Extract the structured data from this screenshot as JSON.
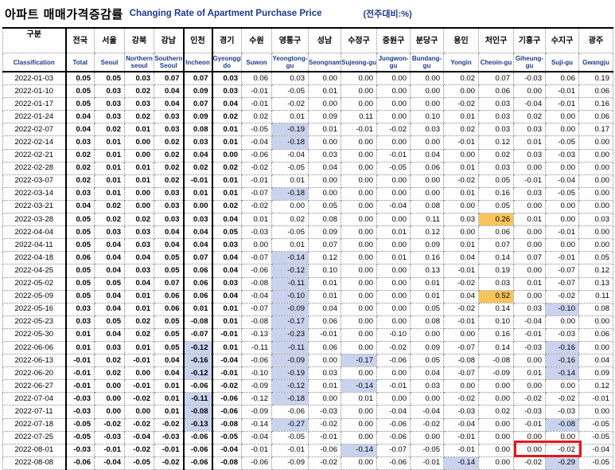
{
  "title": {
    "ko": "아파트 매매가격증감률",
    "en": "Changing Rate of Apartment Purchase Price",
    "unit": "(전주대비:%)"
  },
  "columns": [
    {
      "ko": "구분",
      "en": "Classification"
    },
    {
      "ko": "전국",
      "en": "Total"
    },
    {
      "ko": "서울",
      "en": "Seoul"
    },
    {
      "ko": "강북",
      "en": "Northern seoul"
    },
    {
      "ko": "강남",
      "en": "Southern Seoul"
    },
    {
      "ko": "인천",
      "en": "Incheon"
    },
    {
      "ko": "경기",
      "en": "Gyeonggi-do"
    },
    {
      "ko": "수원",
      "en": "Suwon"
    },
    {
      "ko": "영통구",
      "en": "Yeongtong-gu"
    },
    {
      "ko": "성남",
      "en": "Seongnam"
    },
    {
      "ko": "수정구",
      "en": "Sujeong-gu"
    },
    {
      "ko": "중원구",
      "en": "Jungwon-gu"
    },
    {
      "ko": "분당구",
      "en": "Bundang-gu"
    },
    {
      "ko": "용인",
      "en": "Yongin"
    },
    {
      "ko": "처인구",
      "en": "Cheoin-gu"
    },
    {
      "ko": "기흥구",
      "en": "Giheung-gu"
    },
    {
      "ko": "수지구",
      "en": "Suji-gu"
    },
    {
      "ko": "광주",
      "en": "Gwangju"
    }
  ],
  "rows": [
    [
      "2022-01-03",
      "0.05",
      "0.05",
      "0.03",
      "0.07",
      "0.07",
      "0.03",
      "0.06",
      "0.03",
      "0.00",
      "0.00",
      "0.00",
      "0.00",
      "0.02",
      "0.07",
      "-0.03",
      "0.06",
      "0.19"
    ],
    [
      "2022-01-10",
      "0.05",
      "0.03",
      "0.02",
      "0.04",
      "0.09",
      "0.03",
      "-0.01",
      "-0.05",
      "0.01",
      "0.00",
      "0.00",
      "0.00",
      "0.00",
      "0.06",
      "0.00",
      "-0.01",
      "0.06"
    ],
    [
      "2022-01-17",
      "0.05",
      "0.03",
      "0.03",
      "0.04",
      "0.07",
      "0.04",
      "-0.01",
      "-0.02",
      "0.00",
      "0.00",
      "0.00",
      "0.00",
      "-0.02",
      "0.03",
      "-0.04",
      "-0.01",
      "0.16"
    ],
    [
      "2022-01-24",
      "0.04",
      "0.03",
      "0.02",
      "0.03",
      "0.09",
      "0.02",
      "0.02",
      "0.01",
      "0.09",
      "0.11",
      "0.00",
      "0.10",
      "0.01",
      "0.03",
      "0.02",
      "0.00",
      "0.06"
    ],
    [
      "2022-02-07",
      "0.04",
      "0.02",
      "0.01",
      "0.03",
      "0.08",
      "0.01",
      "-0.05",
      "-0.19",
      "0.01",
      "-0.01",
      "-0.02",
      "0.03",
      "0.02",
      "0.03",
      "0.03",
      "0.00",
      "0.17"
    ],
    [
      "2022-02-14",
      "0.03",
      "0.01",
      "0.00",
      "0.02",
      "0.03",
      "0.01",
      "-0.04",
      "-0.18",
      "0.00",
      "0.00",
      "0.00",
      "0.00",
      "-0.01",
      "0.12",
      "0.01",
      "-0.05",
      "0.00"
    ],
    [
      "2022-02-21",
      "0.02",
      "0.01",
      "0.00",
      "0.02",
      "0.04",
      "0.00",
      "-0.06",
      "-0.04",
      "0.03",
      "0.00",
      "-0.01",
      "0.04",
      "0.00",
      "0.02",
      "0.03",
      "-0.03",
      "0.00"
    ],
    [
      "2022-02-28",
      "0.02",
      "0.01",
      "0.01",
      "0.02",
      "0.02",
      "0.02",
      "-0.02",
      "-0.05",
      "0.04",
      "0.00",
      "-0.05",
      "0.06",
      "0.01",
      "0.03",
      "0.00",
      "0.00",
      "0.00"
    ],
    [
      "2022-03-07",
      "0.02",
      "0.01",
      "0.01",
      "0.02",
      "-0.01",
      "0.01",
      "-0.01",
      "0.01",
      "0.00",
      "0.00",
      "0.00",
      "0.00",
      "-0.02",
      "0.05",
      "-0.01",
      "-0.04",
      "0.00"
    ],
    [
      "2022-03-14",
      "0.03",
      "0.01",
      "0.00",
      "0.03",
      "0.01",
      "0.01",
      "-0.07",
      "-0.18",
      "0.00",
      "0.00",
      "0.00",
      "0.00",
      "0.01",
      "0.16",
      "0.03",
      "-0.05",
      "0.00"
    ],
    [
      "2022-03-21",
      "0.04",
      "0.02",
      "0.00",
      "0.03",
      "0.00",
      "0.02",
      "-0.02",
      "0.00",
      "0.05",
      "0.00",
      "-0.04",
      "0.08",
      "0.00",
      "0.05",
      "0.00",
      "0.00",
      "0.00"
    ],
    [
      "2022-03-28",
      "0.05",
      "0.02",
      "0.02",
      "0.03",
      "0.03",
      "0.04",
      "0.01",
      "0.02",
      "0.08",
      "0.00",
      "0.00",
      "0.11",
      "0.03",
      "0.26",
      "0.01",
      "0.00",
      "0.03"
    ],
    [
      "2022-04-04",
      "0.05",
      "0.03",
      "0.03",
      "0.04",
      "0.04",
      "0.05",
      "-0.03",
      "-0.05",
      "0.09",
      "0.00",
      "0.01",
      "0.12",
      "0.00",
      "0.06",
      "0.00",
      "-0.01",
      "0.00"
    ],
    [
      "2022-04-11",
      "0.05",
      "0.04",
      "0.03",
      "0.04",
      "0.04",
      "0.03",
      "0.00",
      "0.01",
      "0.07",
      "0.00",
      "0.00",
      "0.09",
      "0.01",
      "0.07",
      "0.00",
      "0.00",
      "0.00"
    ],
    [
      "2022-04-18",
      "0.06",
      "0.04",
      "0.04",
      "0.05",
      "0.07",
      "0.04",
      "-0.07",
      "-0.14",
      "0.12",
      "0.00",
      "0.01",
      "0.16",
      "0.04",
      "0.14",
      "0.07",
      "-0.01",
      "0.05"
    ],
    [
      "2022-04-25",
      "0.05",
      "0.04",
      "0.03",
      "0.05",
      "0.06",
      "0.04",
      "-0.06",
      "-0.12",
      "0.10",
      "0.00",
      "0.00",
      "0.13",
      "-0.01",
      "0.19",
      "0.00",
      "-0.07",
      "0.12"
    ],
    [
      "2022-05-02",
      "0.05",
      "0.05",
      "0.04",
      "0.07",
      "0.06",
      "0.03",
      "-0.08",
      "-0.11",
      "0.01",
      "0.00",
      "0.00",
      "0.01",
      "-0.02",
      "0.03",
      "0.01",
      "-0.07",
      "0.13"
    ],
    [
      "2022-05-09",
      "0.05",
      "0.04",
      "0.01",
      "0.06",
      "0.06",
      "0.04",
      "-0.04",
      "-0.10",
      "0.01",
      "0.00",
      "0.00",
      "0.01",
      "0.04",
      "0.52",
      "0.00",
      "-0.02",
      "0.11"
    ],
    [
      "2022-05-16",
      "0.03",
      "0.04",
      "0.01",
      "0.06",
      "0.01",
      "0.01",
      "-0.07",
      "-0.09",
      "0.04",
      "0.00",
      "0.00",
      "0.05",
      "-0.02",
      "0.14",
      "0.03",
      "-0.10",
      "0.08"
    ],
    [
      "2022-05-23",
      "0.03",
      "0.05",
      "0.02",
      "0.05",
      "-0.08",
      "0.01",
      "-0.08",
      "-0.17",
      "0.06",
      "0.00",
      "0.00",
      "0.08",
      "-0.01",
      "0.10",
      "-0.04",
      "0.00",
      "0.00"
    ],
    [
      "2022-05-30",
      "0.01",
      "0.04",
      "0.02",
      "0.05",
      "-0.07",
      "-0.01",
      "-0.13",
      "-0.23",
      "-0.01",
      "0.00",
      "-0.10",
      "0.00",
      "0.00",
      "0.16",
      "-0.01",
      "-0.03",
      "0.06"
    ],
    [
      "2022-06-06",
      "0.01",
      "0.03",
      "0.01",
      "0.05",
      "-0.12",
      "0.01",
      "-0.11",
      "-0.11",
      "0.06",
      "0.00",
      "-0.02",
      "0.09",
      "-0.07",
      "0.14",
      "-0.03",
      "-0.16",
      "0.00"
    ],
    [
      "2022-06-13",
      "-0.01",
      "0.02",
      "-0.01",
      "0.04",
      "-0.16",
      "-0.04",
      "-0.06",
      "-0.09",
      "0.00",
      "-0.17",
      "-0.06",
      "0.05",
      "-0.08",
      "-0.08",
      "0.00",
      "-0.16",
      "0.04"
    ],
    [
      "2022-06-20",
      "-0.01",
      "0.02",
      "0.00",
      "0.04",
      "-0.12",
      "-0.01",
      "-0.10",
      "-0.19",
      "0.03",
      "0.00",
      "0.00",
      "0.04",
      "-0.07",
      "-0.09",
      "0.01",
      "-0.14",
      "0.09"
    ],
    [
      "2022-06-27",
      "-0.01",
      "0.00",
      "-0.01",
      "0.01",
      "-0.06",
      "-0.02",
      "-0.09",
      "-0.12",
      "0.01",
      "-0.14",
      "-0.01",
      "0.03",
      "0.00",
      "0.00",
      "0.00",
      "0.00",
      "0.12"
    ],
    [
      "2022-07-04",
      "-0.03",
      "0.00",
      "-0.02",
      "0.01",
      "-0.11",
      "-0.06",
      "-0.12",
      "-0.18",
      "0.00",
      "0.01",
      "0.00",
      "0.00",
      "-0.02",
      "0.00",
      "-0.02",
      "-0.02",
      "-0.01"
    ],
    [
      "2022-07-11",
      "-0.03",
      "0.00",
      "0.00",
      "0.01",
      "-0.08",
      "-0.06",
      "-0.09",
      "-0.06",
      "-0.03",
      "0.00",
      "-0.04",
      "-0.04",
      "-0.03",
      "0.02",
      "-0.03",
      "-0.03",
      "0.00"
    ],
    [
      "2022-07-18",
      "-0.05",
      "-0.02",
      "-0.02",
      "-0.02",
      "-0.13",
      "-0.08",
      "-0.14",
      "-0.27",
      "-0.02",
      "0.00",
      "-0.06",
      "-0.02",
      "-0.04",
      "0.00",
      "-0.01",
      "-0.08",
      "-0.05"
    ],
    [
      "2022-07-25",
      "-0.05",
      "-0.03",
      "-0.04",
      "-0.03",
      "-0.06",
      "-0.05",
      "-0.04",
      "-0.05",
      "-0.01",
      "0.00",
      "-0.06",
      "0.00",
      "-0.01",
      "0.00",
      "0.00",
      "0.00",
      "-0.05"
    ],
    [
      "2022-08-01",
      "-0.03",
      "-0.01",
      "-0.02",
      "-0.01",
      "-0.06",
      "-0.04",
      "-0.01",
      "-0.01",
      "-0.06",
      "-0.14",
      "-0.07",
      "-0.05",
      "-0.01",
      "0.00",
      "0.00",
      "-0.02",
      "-0.04"
    ],
    [
      "2022-08-08",
      "-0.06",
      "-0.04",
      "-0.05",
      "-0.02",
      "-0.06",
      "-0.08",
      "-0.06",
      "-0.09",
      "-0.02",
      "0.00",
      "-0.06",
      "-0.01",
      "-0.14",
      "0.00",
      "-0.02",
      "-0.29",
      "-0.05"
    ]
  ],
  "highlights": {
    "blue": [
      [
        4,
        8
      ],
      [
        5,
        8
      ],
      [
        9,
        8
      ],
      [
        14,
        8
      ],
      [
        15,
        8
      ],
      [
        16,
        8
      ],
      [
        17,
        8
      ],
      [
        18,
        8
      ],
      [
        19,
        8
      ],
      [
        20,
        8
      ],
      [
        21,
        8
      ],
      [
        22,
        8
      ],
      [
        23,
        8
      ],
      [
        24,
        8
      ],
      [
        25,
        8
      ],
      [
        27,
        8
      ],
      [
        21,
        5
      ],
      [
        22,
        5
      ],
      [
        23,
        5
      ],
      [
        25,
        5
      ],
      [
        26,
        5
      ],
      [
        27,
        5
      ],
      [
        22,
        10
      ],
      [
        24,
        10
      ],
      [
        29,
        10
      ],
      [
        18,
        16
      ],
      [
        21,
        16
      ],
      [
        22,
        16
      ],
      [
        23,
        16
      ],
      [
        27,
        16
      ],
      [
        30,
        16
      ],
      [
        30,
        13
      ]
    ],
    "orange": [
      [
        11,
        14
      ],
      [
        17,
        14
      ]
    ]
  },
  "colors": {
    "header_en": "#1f3a8a",
    "highlight_blue": "#c9d3ee",
    "highlight_orange": "#f7c45c",
    "box_red": "#e0181f"
  }
}
